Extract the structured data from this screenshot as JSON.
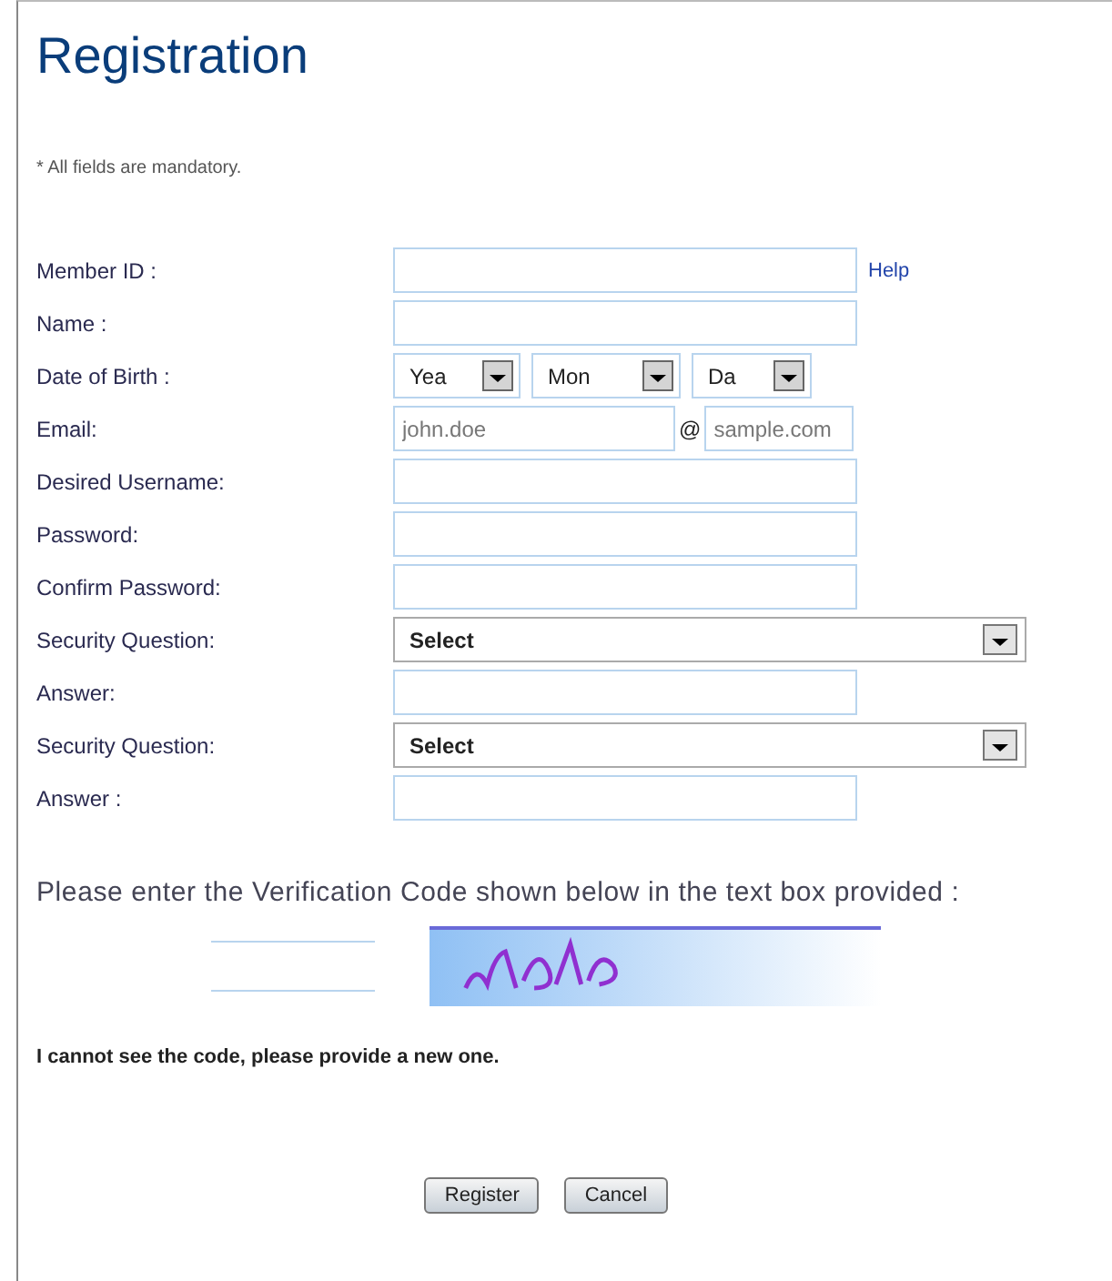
{
  "title": "Registration",
  "note": "* All fields are mandatory.",
  "fields": [
    {
      "kind": "text",
      "label": "Member ID :",
      "help": "Help"
    },
    {
      "kind": "text",
      "label": "Name :"
    },
    {
      "kind": "date",
      "label": "Date of Birth :",
      "parts": [
        "Yea",
        "Mon",
        "Da"
      ]
    },
    {
      "kind": "email",
      "label": "Email:",
      "user_placeholder": "john.doe",
      "at": "@",
      "domain_placeholder": "sample.com"
    },
    {
      "kind": "text",
      "label": "Desired Username:"
    },
    {
      "kind": "text",
      "label": "Password:"
    },
    {
      "kind": "text",
      "label": "Confirm Password:"
    },
    {
      "kind": "select",
      "label": "Security Question:",
      "value": "Select"
    },
    {
      "kind": "text",
      "label": "Answer:"
    },
    {
      "kind": "select",
      "label": "Security Question:",
      "value": "Select"
    },
    {
      "kind": "text",
      "label": "Answer :"
    }
  ],
  "verification": {
    "instruction": "Please enter the Verification Code shown below in the text box provided :",
    "new_code_text": "I cannot see the code, please provide a new one."
  },
  "buttons": [
    "Register",
    "Cancel"
  ]
}
